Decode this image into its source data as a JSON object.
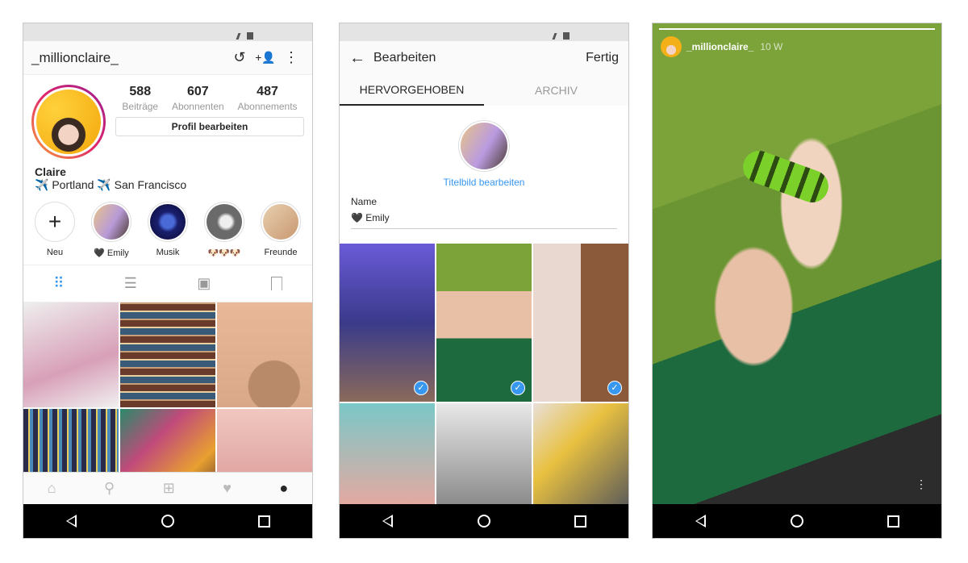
{
  "profile_screen": {
    "username": "_millionclaire_",
    "header_icons": [
      "history-icon",
      "add-user-icon",
      "more-vertical-icon"
    ],
    "stats": [
      {
        "value": "588",
        "label": "Beiträge"
      },
      {
        "value": "607",
        "label": "Abonnenten"
      },
      {
        "value": "487",
        "label": "Abonnements"
      }
    ],
    "edit_profile_label": "Profil bearbeiten",
    "display_name": "Claire",
    "bio": "✈️ Portland ✈️ San Francisco",
    "highlights": [
      {
        "label": "Neu",
        "color": "#ffffff"
      },
      {
        "label": "🖤 Emily",
        "color": "#b89ad8"
      },
      {
        "label": "Musik",
        "color": "#1a1f6e"
      },
      {
        "label": "🐶🐶🐶",
        "color": "#7a7a7a"
      },
      {
        "label": "Freunde",
        "color": "#d8b89a"
      }
    ],
    "tabs": [
      "grid-icon",
      "list-icon",
      "tagged-icon",
      "bookmark-icon"
    ],
    "grid_colors": [
      "#d8a0b8",
      "#8a5a3a",
      "#e8b898",
      "#3a3a6a",
      "#c04a7a",
      "#d89090"
    ],
    "bottom_nav": [
      "home-icon",
      "search-icon",
      "add-icon",
      "heart-icon",
      "profile-icon"
    ]
  },
  "edit_screen": {
    "title": "Bearbeiten",
    "done_label": "Fertig",
    "tabs": [
      "HERVORGEHOBEN",
      "ARCHIV"
    ],
    "cover_link": "Titelbild bearbeiten",
    "name_label": "Name",
    "name_value": "🖤 Emily",
    "grid_colors": [
      "#5a4aa8",
      "#4a8a3a",
      "#c8a080",
      "#7ac8c8",
      "#c8c8c8",
      "#e8e0d8"
    ],
    "checked": [
      true,
      true,
      true,
      false,
      false,
      false
    ],
    "check_glyph": "✓"
  },
  "story_screen": {
    "username": "_millionclaire_",
    "time": "10 W",
    "more_glyph": "⋮"
  },
  "icons": {
    "history": "↺",
    "add_user": "+👤",
    "more": "⋮",
    "back": "←",
    "grid": "⠿",
    "list": "☰",
    "tagged": "▣",
    "bookmark": "🔖",
    "home": "⌂",
    "search": "⚲",
    "add": "⊞",
    "heart": "♥",
    "profile": "●"
  }
}
